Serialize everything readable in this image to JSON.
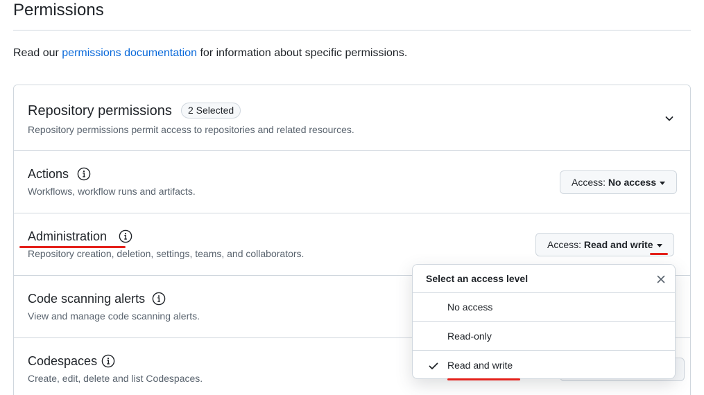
{
  "section": {
    "title": "Permissions",
    "intro_before": "Read our ",
    "intro_link": "permissions documentation",
    "intro_after": " for information about specific permissions."
  },
  "panel": {
    "title": "Repository permissions",
    "badge": "2 Selected",
    "subtitle": "Repository permissions permit access to repositories and related resources."
  },
  "permissions": [
    {
      "name": "Actions",
      "description": "Workflows, workflow runs and artifacts.",
      "access_prefix": "Access:",
      "access_value": "No access"
    },
    {
      "name": "Administration",
      "description": "Repository creation, deletion, settings, teams, and collaborators.",
      "access_prefix": "Access:",
      "access_value": "Read and write"
    },
    {
      "name": "Code scanning alerts",
      "description": "View and manage code scanning alerts.",
      "access_prefix": "",
      "access_value": ""
    },
    {
      "name": "Codespaces",
      "description": "Create, edit, delete and list Codespaces.",
      "access_prefix": "",
      "access_value": ""
    }
  ],
  "access_menu": {
    "title": "Select an access level",
    "options": [
      {
        "label": "No access",
        "selected": false
      },
      {
        "label": "Read-only",
        "selected": false
      },
      {
        "label": "Read and write",
        "selected": true
      }
    ]
  },
  "colors": {
    "link": "#0969da",
    "annotation": "#e4211b",
    "border": "#d0d7de",
    "muted_text": "#59636e"
  },
  "icons": {
    "info": "info-icon",
    "chevron": "chevron-down-icon",
    "close": "close-icon",
    "check": "check-icon"
  }
}
